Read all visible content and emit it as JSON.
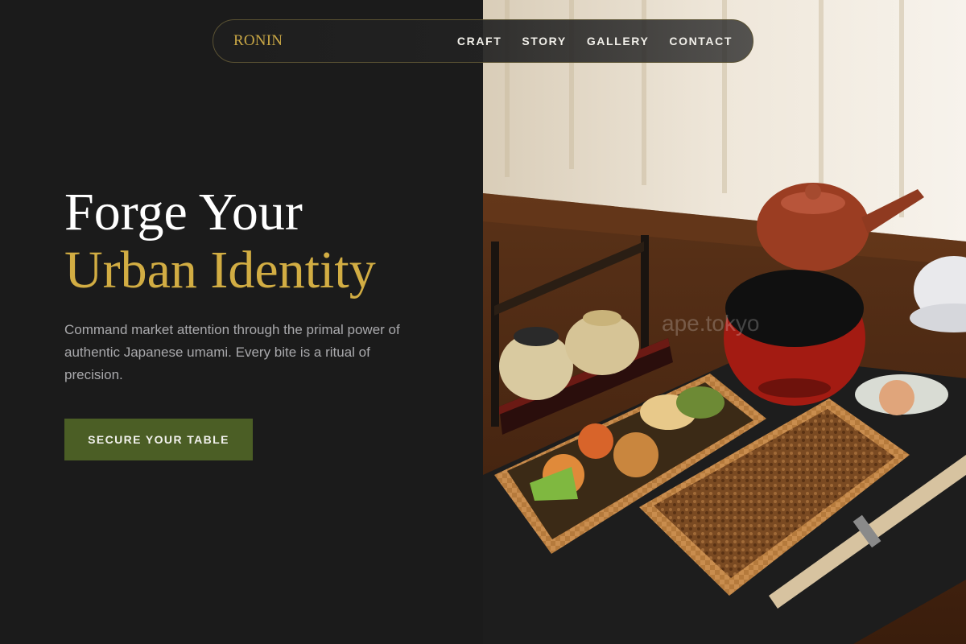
{
  "nav": {
    "brand": "RONIN",
    "links": [
      "CRAFT",
      "STORY",
      "GALLERY",
      "CONTACT"
    ]
  },
  "hero": {
    "title_line1": "Forge Your",
    "title_line2": "Urban Identity",
    "description": "Command market attention through the primal power of authentic Japanese umami. Every bite is a ritual of precision.",
    "cta_label": "SECURE YOUR TABLE"
  },
  "photo": {
    "watermark": "ape.tokyo"
  },
  "colors": {
    "background": "#1b1b1b",
    "accent_gold": "#d2ad43",
    "cta_green": "#4b5e25",
    "body_text": "#a9a9ac"
  }
}
